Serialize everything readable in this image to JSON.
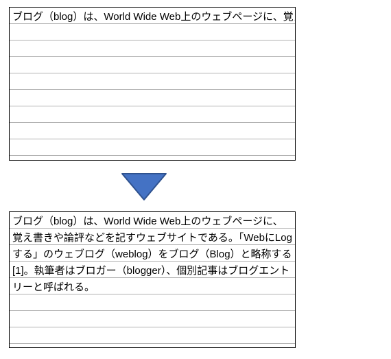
{
  "colors": {
    "arrow_fill": "#4472c4",
    "arrow_stroke": "#2f528f",
    "rule": "#b0b0b0",
    "border": "#000000"
  },
  "figure": {
    "top_box": {
      "text": "ブログ（blog）は、World Wide Web上のウェブページに、覚え"
    },
    "bottom_box": {
      "text": "ブログ（blog）は、World Wide Web上のウェブページに、覚え書きや論評などを記すウェブサイトである。「WebにLogする」のウェブログ（weblog）をブログ（Blog）と略称する[1]。執筆者はブロガー（blogger）、個別記事はブログエントリーと呼ばれる。"
    },
    "arrow": {
      "label": "down-arrow"
    }
  }
}
